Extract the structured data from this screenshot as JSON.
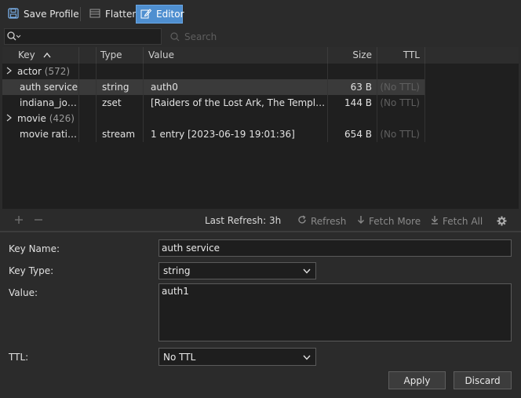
{
  "toolbar": {
    "save_profile": "Save Profile",
    "flatten": "Flatten",
    "editor": "Editor"
  },
  "search": {
    "placeholder": "Search"
  },
  "columns": {
    "key": "Key",
    "type": "Type",
    "value": "Value",
    "size": "Size",
    "ttl": "TTL"
  },
  "rows": [
    {
      "key": "actor",
      "count": "(572)",
      "type": "",
      "value": "",
      "size": "",
      "ttl": ""
    },
    {
      "key": "auth service",
      "type": "string",
      "value": "auth0",
      "size": "63 B",
      "ttl": "(No TTL)"
    },
    {
      "key": "indiana_jon...",
      "type": "zset",
      "value": "[Raiders of the Lost Ark, The Temple of ...",
      "size": "144 B",
      "ttl": "(No TTL)"
    },
    {
      "key": "movie",
      "count": "(426)",
      "type": "",
      "value": "",
      "size": "",
      "ttl": ""
    },
    {
      "key": "movie rating",
      "type": "stream",
      "value": "1 entry [2023-06-19 19:01:36]",
      "size": "654 B",
      "ttl": "(No TTL)"
    }
  ],
  "table_bar": {
    "last_refresh": "Last Refresh: 3h",
    "refresh": "Refresh",
    "fetch_more": "Fetch More",
    "fetch_all": "Fetch All"
  },
  "editor": {
    "key_name_label": "Key Name:",
    "key_name_value": "auth service",
    "key_type_label": "Key Type:",
    "key_type_value": "string",
    "value_label": "Value:",
    "value_value": "auth1",
    "ttl_label": "TTL:",
    "ttl_value": "No TTL",
    "apply": "Apply",
    "discard": "Discard"
  },
  "colors": {
    "accent": "#4f8fd0",
    "background": "#2b2b2b",
    "table_background": "#1f1f1f",
    "selected_row": "#3a3a3a"
  },
  "icons": {
    "save_profile": "floppy-disk-icon",
    "flatten": "list-lines-icon",
    "editor": "pencil-edit-icon",
    "search": "magnifier-icon",
    "refresh": "circular-arrow-icon",
    "fetch_more": "down-arrow-icon",
    "fetch_all": "down-arrow-bar-icon",
    "settings": "gear-icon"
  }
}
